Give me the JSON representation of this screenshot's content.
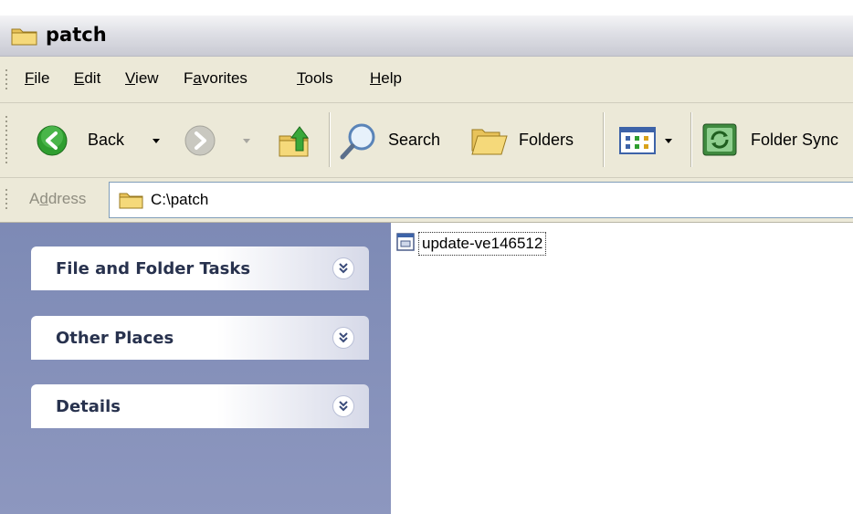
{
  "window": {
    "title": "patch"
  },
  "menu": {
    "items": [
      {
        "mnemonic": "F",
        "rest": "ile"
      },
      {
        "mnemonic": "E",
        "rest": "dit"
      },
      {
        "mnemonic": "V",
        "rest": "iew"
      },
      {
        "pre": "F",
        "mnemonic": "a",
        "rest": "vorites"
      },
      {
        "mnemonic": "T",
        "rest": "ools"
      },
      {
        "mnemonic": "H",
        "rest": "elp"
      }
    ]
  },
  "toolbar": {
    "back_label": "Back",
    "search_label": "Search",
    "folders_label": "Folders",
    "folder_sync_label": "Folder Sync"
  },
  "address": {
    "label_pre": "A",
    "label_mnemonic": "d",
    "label_rest": "dress",
    "path": "C:\\patch"
  },
  "taskpane": {
    "panels": [
      {
        "title": "File and Folder Tasks"
      },
      {
        "title": "Other Places"
      },
      {
        "title": "Details"
      }
    ]
  },
  "files": [
    {
      "name": "update-ve146512"
    }
  ],
  "icons": {
    "window": "folder-icon",
    "back": "back-arrow-icon",
    "forward": "forward-arrow-icon",
    "up": "folder-up-icon",
    "search": "magnifier-icon",
    "folders": "folders-icon",
    "views": "views-icon",
    "folder_sync": "folder-sync-icon",
    "file": "executable-file-icon",
    "panel_toggle": "chevron-double-down-icon"
  },
  "colors": {
    "taskpane_bg": "#7d8ab5",
    "chrome_bg": "#ece9d8",
    "back_green": "#2f9e2f"
  }
}
